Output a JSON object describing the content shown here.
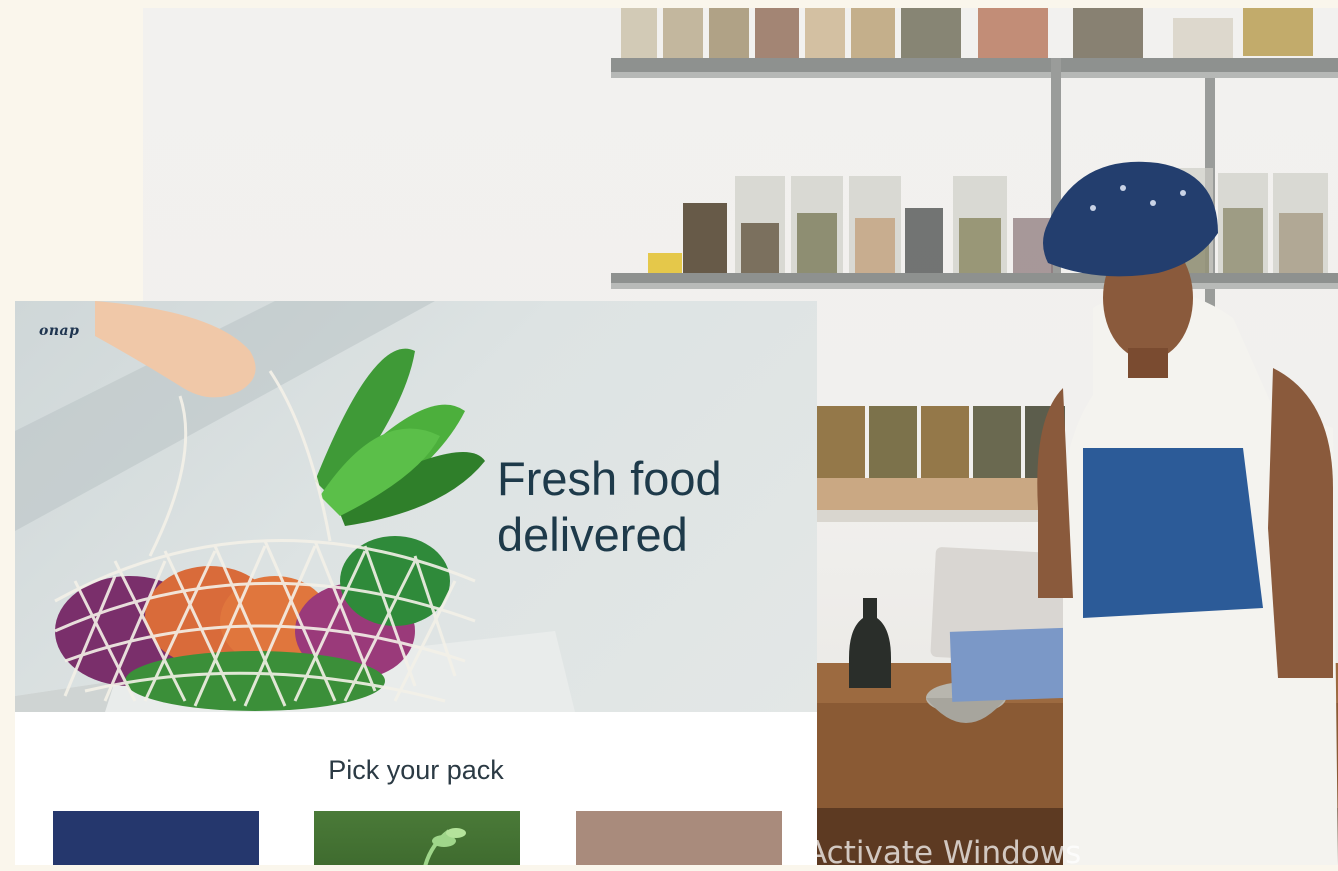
{
  "email": {
    "brand": "onap",
    "hero_headline_line1": "Fresh food",
    "hero_headline_line2": "delivered",
    "pack_section_title": "Pick your pack",
    "pack_tiles": [
      {
        "name": "blue-pack",
        "color": "#25376d"
      },
      {
        "name": "green-pack",
        "color": "#4a7a38"
      },
      {
        "name": "tan-pack",
        "color": "#a98b7c"
      }
    ]
  },
  "background": {
    "scene": "kitchen-woman-tablet",
    "accent_colors": {
      "apron": "#2c5b98",
      "headwrap": "#233e6e",
      "counter": "#8a5a34"
    }
  },
  "os_overlay": {
    "watermark": "Activate Windows"
  }
}
